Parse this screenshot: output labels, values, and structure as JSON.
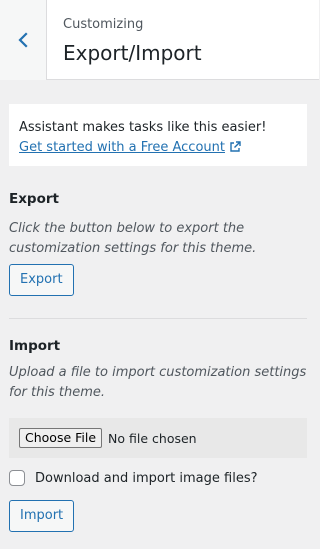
{
  "header": {
    "subtitle": "Customizing",
    "title": "Export/Import"
  },
  "notice": {
    "text": "Assistant makes tasks like this easier!",
    "link": "Get started with a Free Account"
  },
  "export": {
    "title": "Export",
    "description": "Click the button below to export the customization settings for this theme.",
    "button": "Export"
  },
  "import": {
    "title": "Import",
    "description": "Upload a file to import customization settings for this theme.",
    "file_button": "Choose File",
    "file_status": "No file chosen",
    "checkbox_label": "Download and import image files?",
    "button": "Import"
  },
  "colors": {
    "accent": "#2271b1",
    "background": "#f0f0f1",
    "panel": "#ffffff"
  },
  "icons": {
    "back": "chevron-left-icon",
    "external": "external-link-icon"
  }
}
